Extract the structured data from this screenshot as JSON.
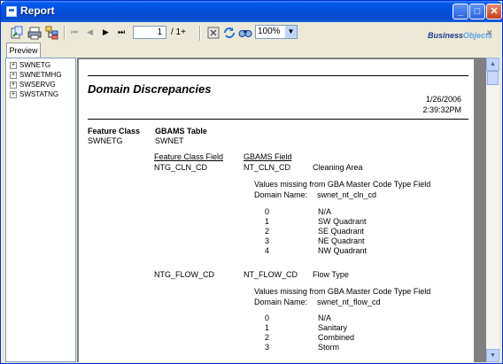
{
  "window": {
    "title": "Report"
  },
  "toolbar": {
    "page_current": "1",
    "page_total": "/ 1+",
    "zoom": "100%",
    "brand_part1": "Business",
    "brand_part2": "Objects"
  },
  "tabs": {
    "preview_label": "Preview"
  },
  "group_tree": {
    "items": [
      "SWNETG",
      "SWNETMHG",
      "SWSERVG",
      "SWSTATNG"
    ]
  },
  "report": {
    "title": "Domain Discrepancies",
    "date": "1/26/2006",
    "time": "2:39:32PM",
    "col_feature_class": "Feature Class",
    "col_gbams_table": "GBAMS Table",
    "feature_class_value": "SWNETG",
    "gbams_table_value": "SWNET",
    "col_feature_class_field": "Feature Class Field",
    "col_gbams_field": "GBAMS Field",
    "field_groups": [
      {
        "fc_field": "NTG_CLN_CD",
        "gbams_field": "NT_CLN_CD",
        "description": "Cleaning Area",
        "missing_note": "Values missing from GBA Master Code Type Field",
        "domain_label": "Domain Name:",
        "domain_name": "swnet_nt_cln_cd",
        "values": [
          {
            "code": "0",
            "desc": "N/A"
          },
          {
            "code": "1",
            "desc": "SW Quadrant"
          },
          {
            "code": "2",
            "desc": "SE Quadrant"
          },
          {
            "code": "3",
            "desc": "NE Quadrant"
          },
          {
            "code": "4",
            "desc": "NW Quadrant"
          }
        ]
      },
      {
        "fc_field": "NTG_FLOW_CD",
        "gbams_field": "NT_FLOW_CD",
        "description": "Flow Type",
        "missing_note": "Values missing from GBA Master Code Type Field",
        "domain_label": "Domain Name:",
        "domain_name": "swnet_nt_flow_cd",
        "values": [
          {
            "code": "0",
            "desc": "N/A"
          },
          {
            "code": "1",
            "desc": "Sanitary"
          },
          {
            "code": "2",
            "desc": "Combined"
          },
          {
            "code": "3",
            "desc": "Storm"
          }
        ]
      }
    ]
  }
}
